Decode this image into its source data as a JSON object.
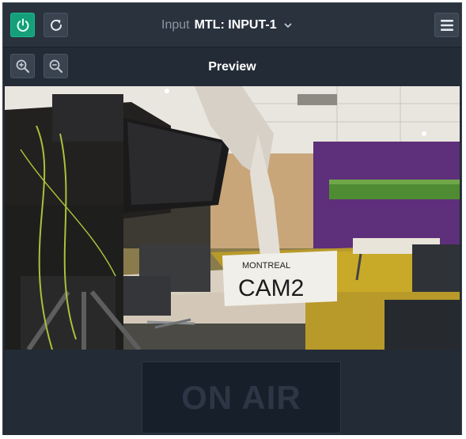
{
  "header": {
    "input_label": "Input",
    "input_value": "MTL: INPUT-1",
    "power_icon": "power-icon",
    "refresh_icon": "refresh-icon",
    "menu_icon": "hamburger-menu-icon",
    "dropdown_icon": "chevron-down-icon"
  },
  "preview": {
    "title": "Preview",
    "zoom_in_icon": "zoom-in-icon",
    "zoom_out_icon": "zoom-out-icon",
    "video_sign_line1": "MONTREAL",
    "video_sign_line2": "CAM2"
  },
  "on_air": {
    "label": "ON AIR"
  },
  "colors": {
    "accent_green": "#15a079",
    "panel_bg": "#232b36",
    "onair_bg": "#171f2a"
  }
}
